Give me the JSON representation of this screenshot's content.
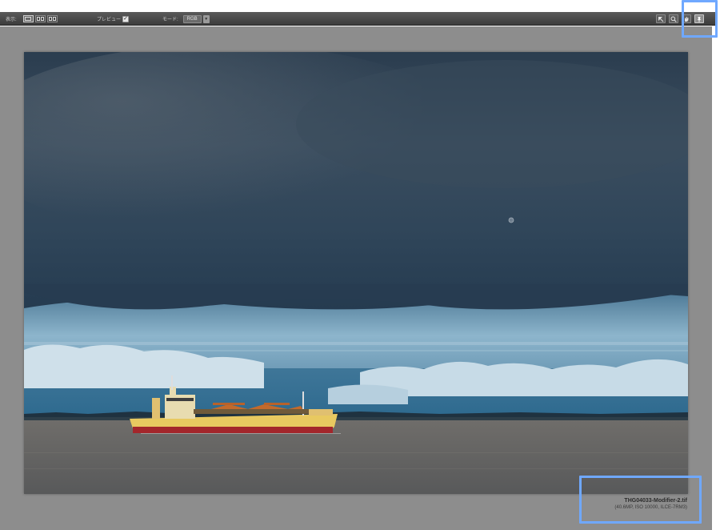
{
  "toolbar": {
    "view_label": "表示:",
    "view_modes": [
      "single-view",
      "side-by-side-view",
      "split-view"
    ],
    "preview_label": "プレビュー",
    "preview_checked": true,
    "checkmark": "✓",
    "mode_label": "モード:",
    "mode_value": "RGB",
    "tools": [
      "arrow-tool-icon",
      "zoom-tool-icon",
      "hand-tool-icon",
      "pin-tool-icon"
    ]
  },
  "image": {
    "file_name": "THG04033-Modifier-2.tif",
    "file_meta": "(40.6MP, ISO 10000, ILCE-7RM3)"
  },
  "colors": {
    "toolbar_bg": "#3c3c3c",
    "canvas_bg": "#8d8d8d",
    "highlight": "#6fa8ff"
  }
}
